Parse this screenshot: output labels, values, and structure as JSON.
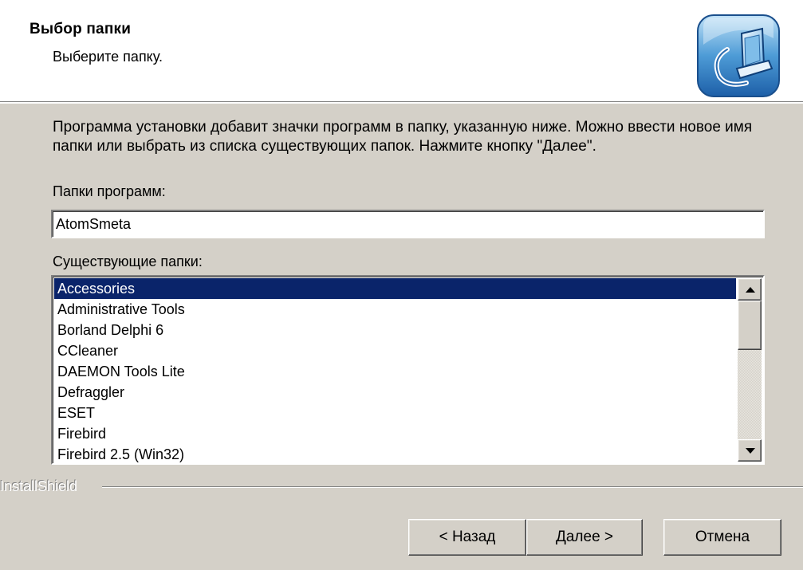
{
  "header": {
    "title": "Выбор папки",
    "subtitle": "Выберите папку."
  },
  "instructions": "Программа установки добавит значки программ в папку, указанную ниже.  Можно ввести новое имя папки или выбрать из списка существующих папок.  Нажмите кнопку \"Далее\".",
  "program_folder": {
    "label": "Папки программ:",
    "value": "AtomSmeta"
  },
  "existing_folders": {
    "label": "Существующие папки:",
    "selected": "Accessories",
    "items": [
      "Accessories",
      "Administrative Tools",
      "Borland Delphi 6",
      "CCleaner",
      "DAEMON Tools Lite",
      "Defraggler",
      "ESET",
      "Firebird",
      "Firebird 2.5 (Win32)"
    ]
  },
  "footer": {
    "brand": "InstallShield"
  },
  "buttons": {
    "back": "< Назад",
    "next": "Далее >",
    "cancel": "Отмена"
  },
  "colors": {
    "dialog_bg": "#d4d0c8",
    "header_bg": "#ffffff",
    "selection_bg": "#0a246a"
  },
  "icons": {
    "header": "computer-setup-icon",
    "scroll_up": "arrow-up-icon",
    "scroll_down": "arrow-down-icon"
  }
}
